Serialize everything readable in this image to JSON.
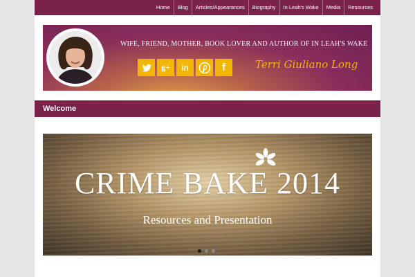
{
  "nav": {
    "items": [
      {
        "label": "Home"
      },
      {
        "label": "Blog"
      },
      {
        "label": "Articles/Appearances"
      },
      {
        "label": "Biography"
      },
      {
        "label": "In Leah's Wake"
      },
      {
        "label": "Media"
      },
      {
        "label": "Resources"
      }
    ]
  },
  "header": {
    "tagline": "WIFE, FRIEND, MOTHER, BOOK LOVER AND AUTHOR OF IN LEAH'S WAKE",
    "signature": "Terri Giuliano Long",
    "social": [
      {
        "icon": "twitter-icon",
        "glyph": "t"
      },
      {
        "icon": "google-plus-icon",
        "glyph": "g+"
      },
      {
        "icon": "linkedin-icon",
        "glyph": "in"
      },
      {
        "icon": "pinterest-icon",
        "glyph": "P"
      },
      {
        "icon": "facebook-icon",
        "glyph": "f"
      }
    ]
  },
  "welcome": {
    "title": "Welcome"
  },
  "slider": {
    "title": "CRIME BAKE 2014",
    "subtitle": "Resources and Presentation",
    "dots": 3,
    "active_dot": 1
  },
  "colors": {
    "brand": "#7a2249",
    "social_bg": "#f2b705"
  }
}
